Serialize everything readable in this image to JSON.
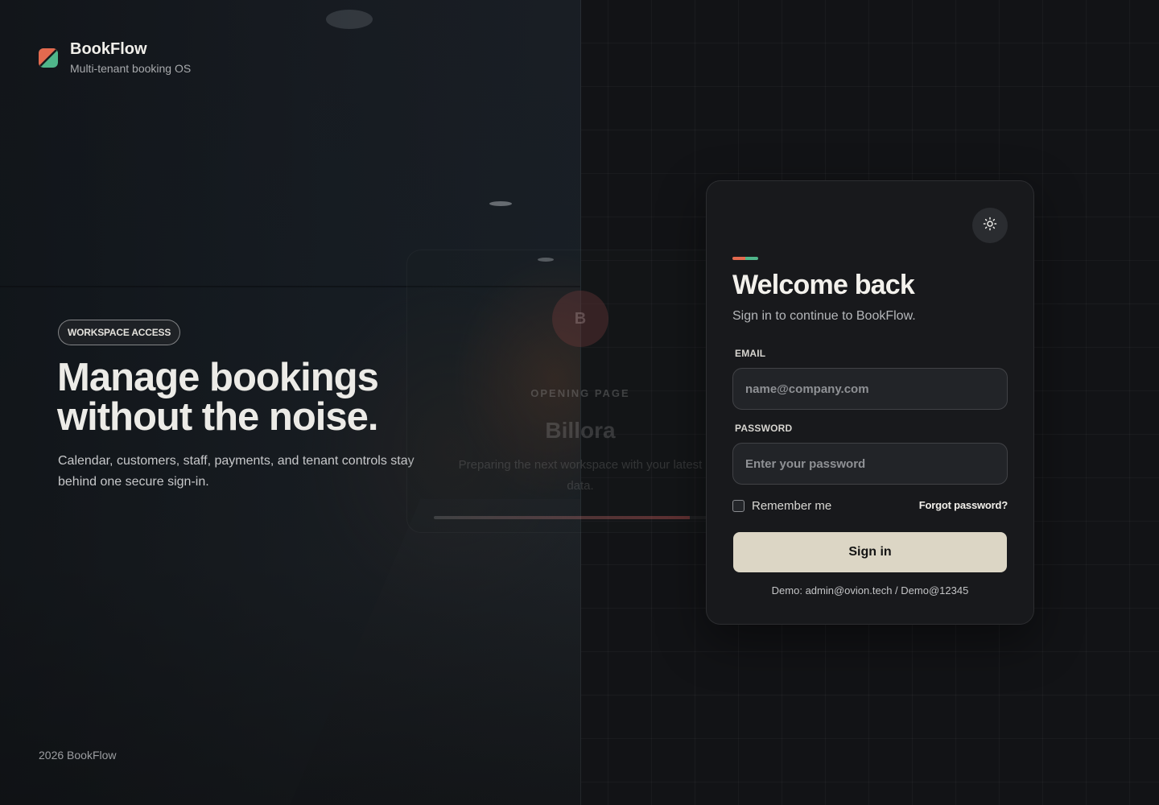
{
  "brand": {
    "name": "BookFlow",
    "tagline": "Multi-tenant booking OS",
    "logo_colors": [
      "#e36a4f",
      "#4fb58a"
    ]
  },
  "hero": {
    "badge": "WORKSPACE ACCESS",
    "title_line1": "Manage bookings",
    "title_line2": "without the noise.",
    "subtitle": "Calendar, customers, staff, payments, and tenant controls stay behind one secure sign-in."
  },
  "opening_overlay": {
    "avatar_letter": "B",
    "kicker": "OPENING PAGE",
    "title": "Billora",
    "text": "Preparing the next workspace with your latest data.",
    "progress": 0.87
  },
  "login": {
    "theme_toggle_icon": "sun-icon",
    "title": "Welcome back",
    "subtitle": "Sign in to continue to BookFlow.",
    "email_label": "EMAIL",
    "email_placeholder": "name@company.com",
    "email_value": "",
    "password_label": "PASSWORD",
    "password_placeholder": "Enter your password",
    "password_value": "",
    "remember_label": "Remember me",
    "remember_checked": false,
    "forgot_label": "Forgot password?",
    "submit_label": "Sign in",
    "demo_text": "Demo: admin@ovion.tech / Demo@12345"
  },
  "footer": {
    "text": "2026 BookFlow"
  },
  "colors": {
    "background": "#121316",
    "card": "#18191c",
    "primary_button": "#dcd6c5",
    "accent_orange": "#e36a4f",
    "accent_green": "#4fb58a"
  }
}
